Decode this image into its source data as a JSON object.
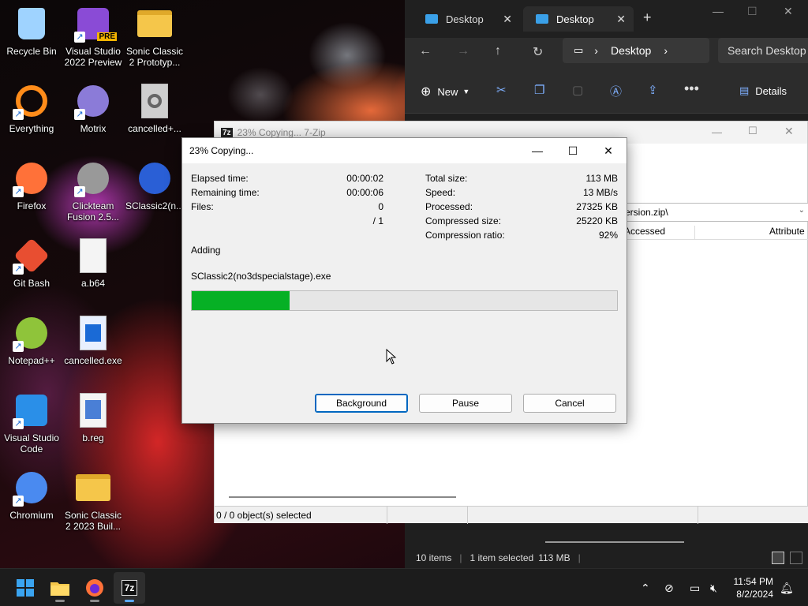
{
  "desktop": {
    "icons": [
      {
        "label": "Recycle Bin",
        "icon": "recycle-bin-icon"
      },
      {
        "label": "Visual Studio 2022 Preview",
        "icon": "visual-studio-icon",
        "badge": "PRE"
      },
      {
        "label": "Sonic Classic 2 Prototyp...",
        "icon": "folder-icon"
      },
      {
        "label": "Everything",
        "icon": "everything-search-icon"
      },
      {
        "label": "Motrix",
        "icon": "motrix-icon"
      },
      {
        "label": "cancelled+...",
        "icon": "settings-file-icon"
      },
      {
        "label": "Firefox",
        "icon": "firefox-icon"
      },
      {
        "label": "Clickteam Fusion 2.5...",
        "icon": "clickteam-icon"
      },
      {
        "label": "SClassic2(n...",
        "icon": "sonic-icon"
      },
      {
        "label": "Git Bash",
        "icon": "git-bash-icon"
      },
      {
        "label": "a.b64",
        "icon": "file-icon"
      },
      {
        "label": "Notepad++",
        "icon": "notepadpp-icon"
      },
      {
        "label": "cancelled.exe",
        "icon": "exe-icon"
      },
      {
        "label": "Visual Studio Code",
        "icon": "vscode-icon"
      },
      {
        "label": "b.reg",
        "icon": "registry-icon"
      },
      {
        "label": "Chromium",
        "icon": "chromium-icon"
      },
      {
        "label": "Sonic Classic 2 2023 Buil...",
        "icon": "folder-icon"
      }
    ]
  },
  "explorer": {
    "tabs": [
      {
        "label": "Desktop"
      },
      {
        "label": "Desktop"
      }
    ],
    "new_tab": "+",
    "address": "Desktop",
    "search_placeholder": "Search Desktop",
    "commands": {
      "new": "New",
      "details": "Details"
    },
    "status": {
      "items": "10 items",
      "selected": "1 item selected",
      "size": "113 MB"
    }
  },
  "zip_main": {
    "title": "23% Copying... 7-Zip",
    "logo": "7z",
    "path_fragment": "ersion.zip\\",
    "columns": [
      "Accessed",
      "Attribute"
    ],
    "status": "0 / 0 object(s) selected"
  },
  "dialog": {
    "title": "23% Copying...",
    "left": [
      {
        "label": "Elapsed time:",
        "value": "00:00:02"
      },
      {
        "label": "Remaining time:",
        "value": "00:00:06"
      },
      {
        "label": "Files:",
        "value": "0"
      },
      {
        "label": "",
        "value": "/ 1"
      }
    ],
    "right": [
      {
        "label": "Total size:",
        "value": "113 MB"
      },
      {
        "label": "Speed:",
        "value": "13 MB/s"
      },
      {
        "label": "Processed:",
        "value": "27325 KB"
      },
      {
        "label": "Compressed size:",
        "value": "25220 KB"
      },
      {
        "label": "Compression ratio:",
        "value": "92%"
      }
    ],
    "operation": "Adding",
    "current_file": "SClassic2(no3dspecialstage).exe",
    "progress_percent": 23,
    "buttons": {
      "background": "Background",
      "pause": "Pause",
      "cancel": "Cancel"
    }
  },
  "taskbar": {
    "clock_time": "11:54 PM",
    "clock_date": "8/2/2024",
    "zip_label": "7z"
  },
  "colors": {
    "progress": "#06b025",
    "accent": "#0067c0"
  }
}
